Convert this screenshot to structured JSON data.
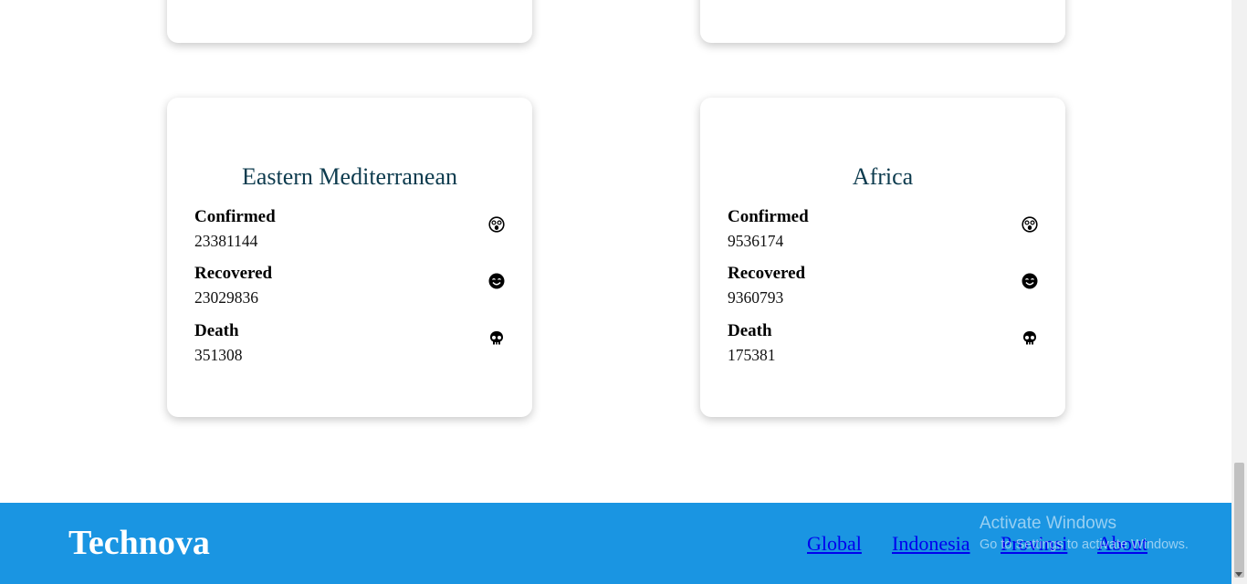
{
  "regions": [
    {
      "name": "Eastern Mediterranean",
      "stats": [
        {
          "label": "Confirmed",
          "value": "23381144",
          "icon": "astonished-face-icon"
        },
        {
          "label": "Recovered",
          "value": "23029836",
          "icon": "smiling-face-icon"
        },
        {
          "label": "Death",
          "value": "351308",
          "icon": "skull-icon"
        }
      ]
    },
    {
      "name": "Africa",
      "stats": [
        {
          "label": "Confirmed",
          "value": "9536174",
          "icon": "astonished-face-icon"
        },
        {
          "label": "Recovered",
          "value": "9360793",
          "icon": "smiling-face-icon"
        },
        {
          "label": "Death",
          "value": "175381",
          "icon": "skull-icon"
        }
      ]
    }
  ],
  "footer": {
    "brand": "Technova",
    "nav": [
      "Global",
      "Indonesia",
      "Provinsi",
      "About"
    ]
  },
  "watermark": {
    "title": "Activate Windows",
    "subtitle": "Go to Settings to activate Windows."
  }
}
